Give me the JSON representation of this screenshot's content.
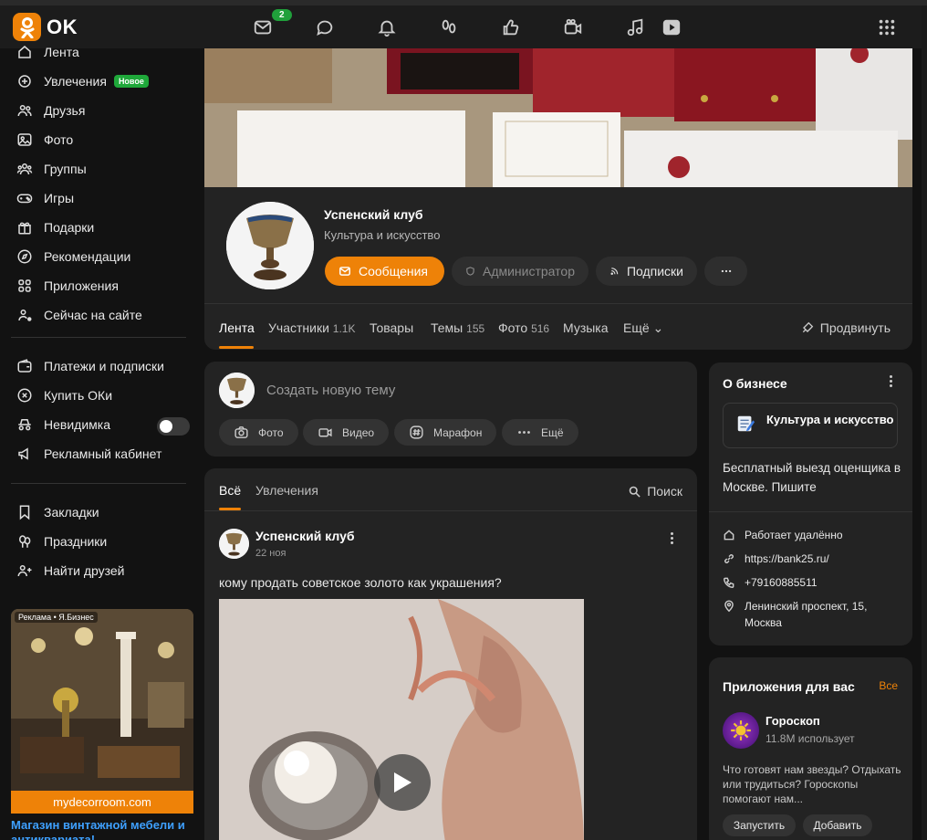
{
  "brand": {
    "logo_text": "OK",
    "accent": "#ee8208"
  },
  "topbar": {
    "messages_badge": "2",
    "icons": [
      "mail-icon",
      "chat-icon",
      "bell-icon",
      "guests-icon",
      "like-icon",
      "video-icon",
      "music-icon",
      "play-icon",
      "apps-grid-icon"
    ]
  },
  "sidebar": {
    "items": [
      {
        "label": "Лента",
        "icon": "home-icon"
      },
      {
        "label": "Увлечения",
        "icon": "hobby-icon",
        "badge": "Новое"
      },
      {
        "label": "Друзья",
        "icon": "friends-icon"
      },
      {
        "label": "Фото",
        "icon": "photo-icon"
      },
      {
        "label": "Группы",
        "icon": "groups-icon"
      },
      {
        "label": "Игры",
        "icon": "games-icon"
      },
      {
        "label": "Подарки",
        "icon": "gift-icon"
      },
      {
        "label": "Рекомендации",
        "icon": "compass-icon"
      },
      {
        "label": "Приложения",
        "icon": "apps-icon"
      },
      {
        "label": "Сейчас на сайте",
        "icon": "online-icon"
      }
    ],
    "items2": [
      {
        "label": "Платежи и подписки",
        "icon": "wallet-icon"
      },
      {
        "label": "Купить ОКи",
        "icon": "coin-icon"
      },
      {
        "label": "Невидимка",
        "icon": "incognito-icon"
      },
      {
        "label": "Рекламный кабинет",
        "icon": "megaphone-icon"
      }
    ],
    "items3": [
      {
        "label": "Закладки",
        "icon": "bookmark-icon"
      },
      {
        "label": "Праздники",
        "icon": "balloons-icon"
      },
      {
        "label": "Найти друзей",
        "icon": "add-friend-icon"
      }
    ],
    "ad": {
      "label": "Реклама • Я.Бизнес",
      "domain": "mydecorroom.com",
      "title": "Магазин винтажной мебели и антиквариата!"
    }
  },
  "group": {
    "name": "Успенский клуб",
    "category": "Культура и искусство",
    "buttons": {
      "messages": "Сообщения",
      "admin": "Администратор",
      "subscriptions": "Подписки"
    },
    "tabs": [
      {
        "label": "Лента",
        "count": ""
      },
      {
        "label": "Участники",
        "count": "1.1K"
      },
      {
        "label": "Товары",
        "count": ""
      },
      {
        "label": "Темы",
        "count": "155"
      },
      {
        "label": "Фото",
        "count": "516"
      },
      {
        "label": "Музыка",
        "count": ""
      },
      {
        "label": "Ещё",
        "count": ""
      }
    ],
    "promote": "Продвинуть"
  },
  "create": {
    "placeholder": "Создать новую тему",
    "chips": [
      "Фото",
      "Видео",
      "Марафон",
      "Ещё"
    ]
  },
  "feed": {
    "tabs": [
      "Всё",
      "Увлечения"
    ],
    "search": "Поиск",
    "post": {
      "author": "Успенский клуб",
      "date": "22 ноя",
      "text": "кому продать советское золото как украшения?"
    }
  },
  "business": {
    "title": "О бизнесе",
    "category": "Культура и искусство",
    "description": "Бесплатный выезд оценщика в Москве. Пишите",
    "rows": [
      {
        "icon": "house-icon",
        "text": "Работает удалённо"
      },
      {
        "icon": "link-icon",
        "text": "https://bank25.ru/"
      },
      {
        "icon": "phone-icon",
        "text": "+79160885511"
      },
      {
        "icon": "location-icon",
        "text": "Ленинский проспект, 15, Москва"
      }
    ]
  },
  "apps": {
    "title": "Приложения для вас",
    "all": "Все",
    "app": {
      "name": "Гороскоп",
      "users": "11.8M использует",
      "description": "Что готовят нам звезды? Отдыхать или трудиться? Гороскопы помогают нам...",
      "launch": "Запустить",
      "add": "Добавить"
    }
  }
}
